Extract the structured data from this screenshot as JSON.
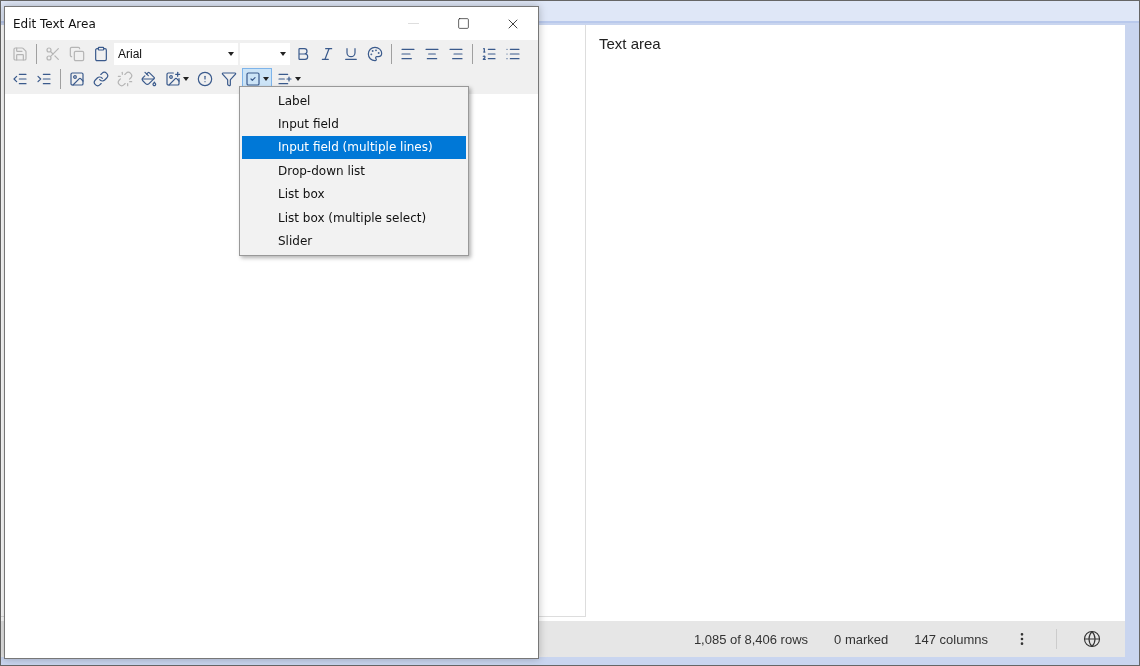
{
  "background_app": {
    "text_area": {
      "text": "Text area"
    },
    "status_bar": {
      "items": [
        "1,085 of 8,406 rows",
        "0 marked",
        "147 columns"
      ]
    }
  },
  "dialog": {
    "title": "Edit Text Area",
    "window_controls": [
      {
        "kind": "minimize",
        "disabled": true
      },
      {
        "kind": "maximize",
        "disabled": false
      },
      {
        "kind": "close",
        "disabled": false
      }
    ],
    "toolbar_row_1": [
      {
        "kind": "button",
        "disabled": true
      },
      {
        "kind": "separator"
      },
      {
        "kind": "button",
        "disabled": true
      },
      {
        "kind": "button",
        "disabled": true
      },
      {
        "kind": "button",
        "disabled": false
      },
      {
        "kind": "select",
        "value": "Arial"
      },
      {
        "kind": "select"
      },
      {
        "kind": "button",
        "disabled": false
      },
      {
        "kind": "button",
        "disabled": false
      },
      {
        "kind": "button",
        "disabled": false
      },
      {
        "kind": "button",
        "disabled": false
      },
      {
        "kind": "separator"
      },
      {
        "kind": "button",
        "disabled": false
      },
      {
        "kind": "button",
        "disabled": false
      },
      {
        "kind": "button",
        "disabled": false
      },
      {
        "kind": "separator"
      },
      {
        "kind": "button",
        "disabled": false
      },
      {
        "kind": "button",
        "disabled": false
      }
    ],
    "toolbar_row_2": [
      {
        "kind": "button",
        "disabled": false
      },
      {
        "kind": "button",
        "disabled": false
      },
      {
        "kind": "separator"
      },
      {
        "kind": "button",
        "disabled": false
      },
      {
        "kind": "button",
        "disabled": false
      },
      {
        "kind": "button",
        "disabled": true
      },
      {
        "kind": "button",
        "disabled": false
      },
      {
        "kind": "dropdown",
        "disabled": false,
        "pressed": false
      },
      {
        "kind": "button",
        "disabled": false
      },
      {
        "kind": "button",
        "disabled": false
      },
      {
        "kind": "dropdown",
        "disabled": false,
        "pressed": true
      },
      {
        "kind": "dropdown",
        "disabled": false,
        "pressed": false
      }
    ],
    "menu": {
      "items": [
        {
          "label": "Label",
          "selected": false
        },
        {
          "label": "Input field",
          "selected": false
        },
        {
          "label": "Input field (multiple lines)",
          "selected": true
        },
        {
          "label": "Drop-down list",
          "selected": false
        },
        {
          "label": "List box",
          "selected": false
        },
        {
          "label": "List box (multiple select)",
          "selected": false
        },
        {
          "label": "Slider",
          "selected": false
        }
      ]
    }
  }
}
